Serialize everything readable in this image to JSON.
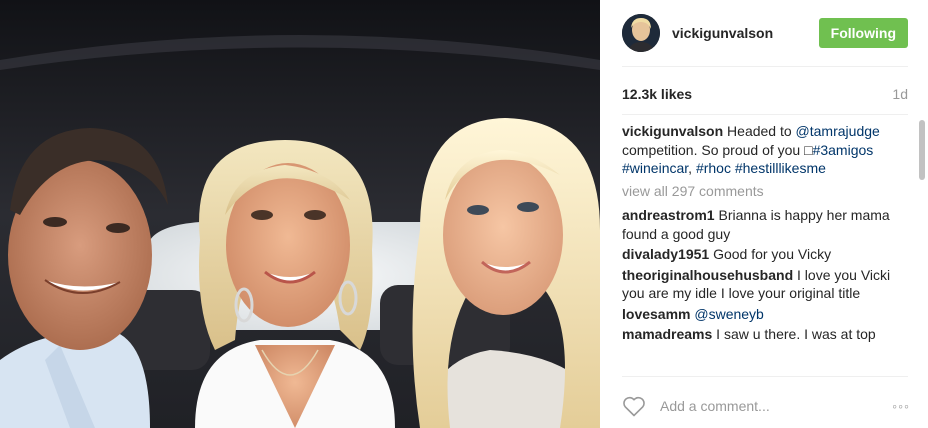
{
  "post": {
    "username": "vickigunvalson",
    "follow_label": "Following",
    "likes": "12.3k likes",
    "time_ago": "1d",
    "caption": {
      "user": "vickigunvalson",
      "text_1": "Headed to ",
      "mention": "@tamrajudge",
      "text_2": " competition. So proud of you □",
      "tag_1": "#3amigos",
      "tag_2": "#wineincar",
      "sep_1": ", ",
      "tag_3": "#rhoc",
      "sep_2": " ",
      "tag_4": "#hestilllikesme"
    },
    "view_all": "view all 297 comments",
    "comments": [
      {
        "user": "andreastrom1",
        "text": "Brianna is happy her mama found a good guy"
      },
      {
        "user": "divalady1951",
        "text": "Good for you Vicky"
      },
      {
        "user": "theoriginalhousehusband",
        "text": "I love you Vicki you are my idle I love your original title"
      },
      {
        "user": "lovesamm",
        "text": "",
        "mention": "@sweneyb"
      },
      {
        "user": "mamadreams",
        "text": "I saw u there. I was at top"
      }
    ],
    "add_comment_placeholder": "Add a comment...",
    "more_label": "◦◦◦",
    "icons": {
      "like": "heart-icon",
      "more": "more-options-icon"
    },
    "colors": {
      "follow_button": "#70c050",
      "link": "#003569",
      "muted": "#999999"
    }
  }
}
